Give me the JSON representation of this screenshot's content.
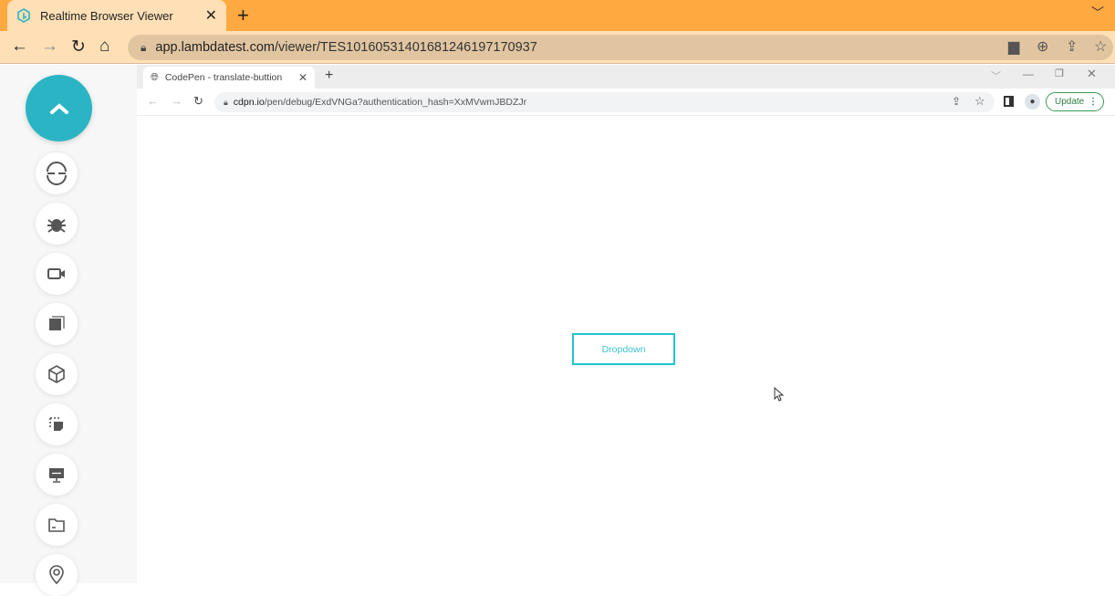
{
  "outer_browser": {
    "tab_title": "Realtime Browser Viewer",
    "url_host": "app.lambdatest.com",
    "url_path": "/viewer/TES1016053140168124619717093​7"
  },
  "sidebar": {
    "items": [
      "collapse",
      "switch-browser",
      "bug",
      "video",
      "screenshots",
      "3d-box",
      "selection",
      "resolution",
      "files",
      "location"
    ]
  },
  "inner_browser": {
    "tab_title": "CodePen - translate-buttion",
    "url_host": "cdpn.io",
    "url_path": "/pen/debug/ExdVNGa?authentication_hash=XxMVwmJBDZJr",
    "update_label": "Update"
  },
  "page": {
    "dropdown_label": "Dropdown"
  },
  "colors": {
    "accent": "#2BB5C4",
    "tabstrip": "#FFA940",
    "button_border": "#1FC4CF"
  }
}
